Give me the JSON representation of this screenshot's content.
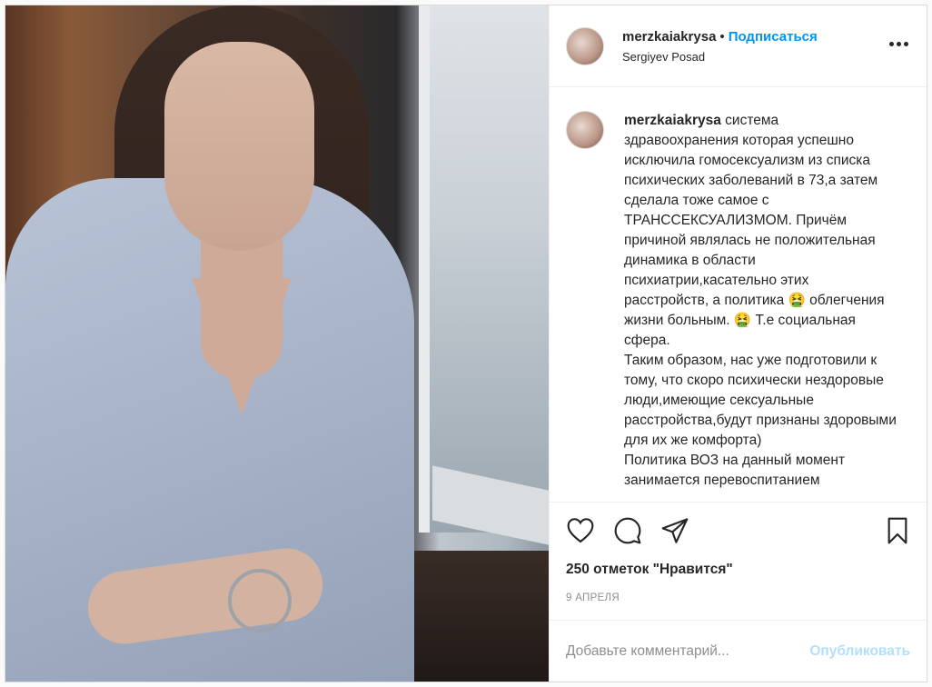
{
  "post": {
    "username": "merzkaiakrysa",
    "separator": "•",
    "follow_label": "Подписаться",
    "location": "Sergiyev Posad",
    "caption_text": " система здравоохранения которая успешно исключила гомосексуализм из списка психических заболеваний в 73,а затем сделала тоже самое с ТРАНССЕКСУАЛИЗМОМ. Причём причиной являлась не положительная динамика в области психиатрии,касательно этих расстройств, а политика 🤮 облегчения жизни больным. 🤮 Т.е социальная сфера.\nТаким образом, нас уже подготовили к тому, что скоро психически нездоровые люди,имеющие сексуальные расстройства,будут признаны здоровыми для их же комфорта)\nПолитика ВОЗ на данный момент занимается перевоспитанием",
    "likes": "250 отметок \"Нравится\"",
    "date": "9 АПРЕЛЯ"
  },
  "comment": {
    "placeholder": "Добавьте комментарий...",
    "publish_label": "Опубликовать"
  },
  "icons": [
    "heart-icon",
    "comment-icon",
    "share-icon",
    "bookmark-icon",
    "more-icon"
  ],
  "colors": {
    "accent": "#0095f6",
    "publish_disabled": "#b2dffc",
    "text": "#262626",
    "muted": "#8e8e8e"
  }
}
